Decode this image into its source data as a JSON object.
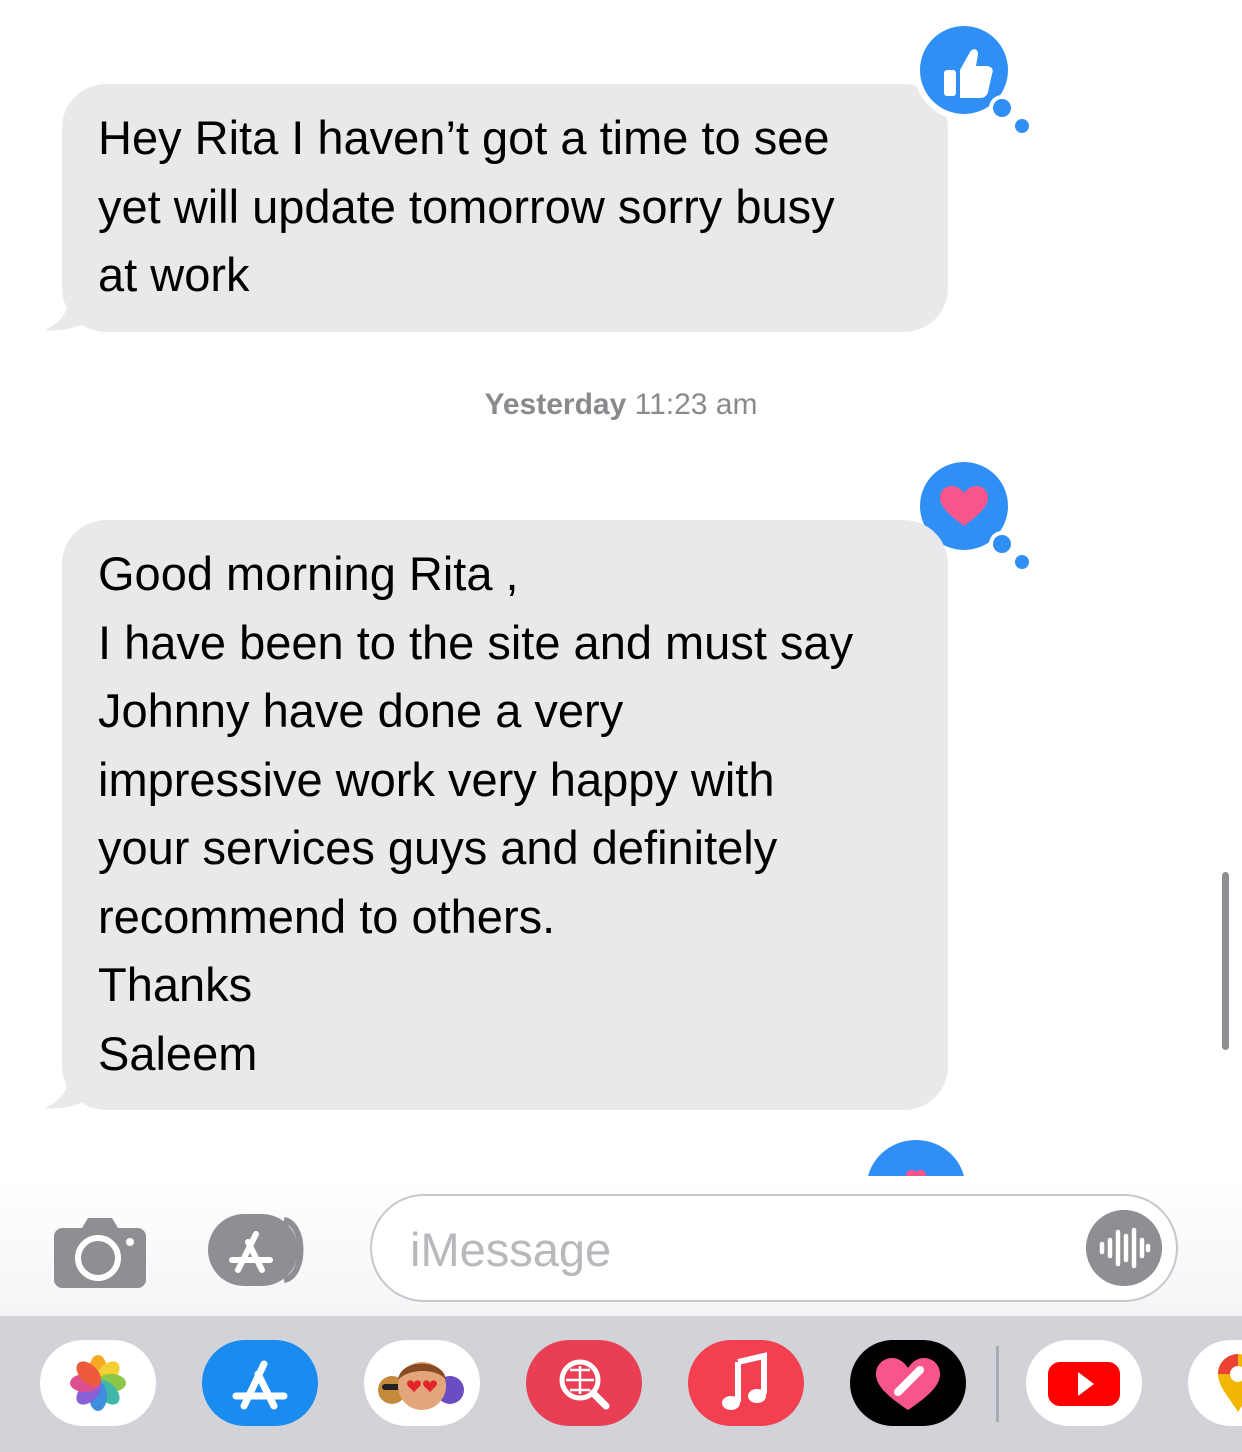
{
  "messages": [
    {
      "lines": [
        "Hey Rita I haven’t got a time to see",
        "yet will update tomorrow sorry busy",
        "at work"
      ],
      "tapback": "thumbs-up"
    },
    {
      "lines": [
        "Good morning Rita ,",
        "I have been to the site and must say",
        "Johnny have done a very",
        "impressive work very happy with",
        "your services guys and definitely",
        "recommend to others.",
        "Thanks",
        "Saleem"
      ],
      "tapback": "heart"
    }
  ],
  "timestamp": {
    "day": "Yesterday",
    "time": "11:23 am"
  },
  "composer": {
    "placeholder": "iMessage"
  },
  "app_tray": [
    "photos-icon",
    "app-store-icon",
    "memoji-stickers-icon",
    "image-search-icon",
    "music-icon",
    "fitness-heart-icon",
    "youtube-icon",
    "google-maps-icon"
  ],
  "colors": {
    "bubble": "#e9e9eb",
    "tapback": "#2f8ff5",
    "heart": "#f8558a",
    "tray": "#d1d3d9"
  }
}
